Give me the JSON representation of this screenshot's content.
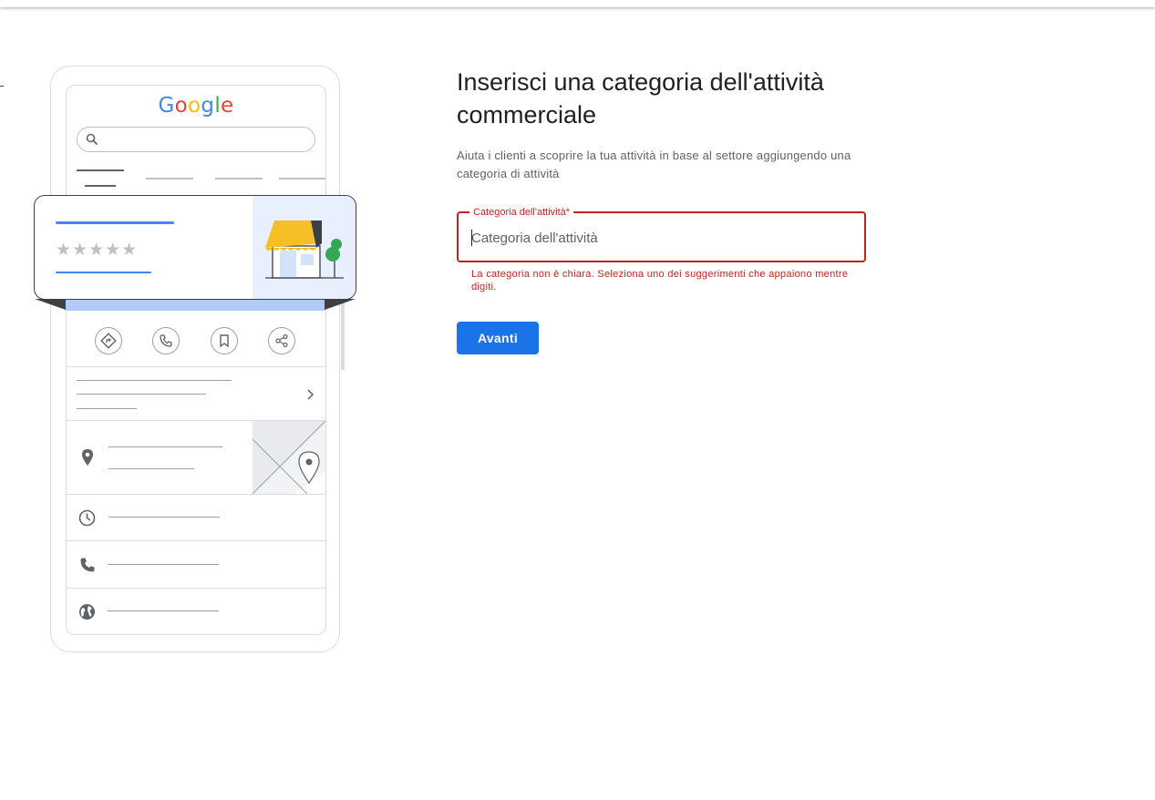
{
  "illustration": {
    "logo_letters": [
      {
        "char": "G",
        "color": "#4285F4"
      },
      {
        "char": "o",
        "color": "#EA4335"
      },
      {
        "char": "o",
        "color": "#FBBC05"
      },
      {
        "char": "g",
        "color": "#4285F4"
      },
      {
        "char": "l",
        "color": "#34A853"
      },
      {
        "char": "e",
        "color": "#EA4335"
      }
    ],
    "stars": "★★★★★",
    "action_icons": [
      "directions-icon",
      "phone-icon",
      "bookmark-icon",
      "share-icon"
    ],
    "info_icons": [
      "location-pin-icon",
      "clock-icon",
      "phone-icon",
      "globe-icon"
    ]
  },
  "form": {
    "title": "Inserisci una categoria dell'attività commerciale",
    "subtitle": "Aiuta i clienti a scoprire la tua attività in base al settore aggiungendo una categoria di attività",
    "field_label": "Categoria dell'attività*",
    "field_placeholder": "Categoria dell'attività",
    "field_value": "",
    "error": "La categoria non è chiara. Seleziona uno dei suggerimenti che appaiono mentre digiti.",
    "next_button": "Avanti"
  },
  "colors": {
    "error": "#C5221F",
    "primary": "#1A73E8",
    "awning": "#F6BF26"
  }
}
